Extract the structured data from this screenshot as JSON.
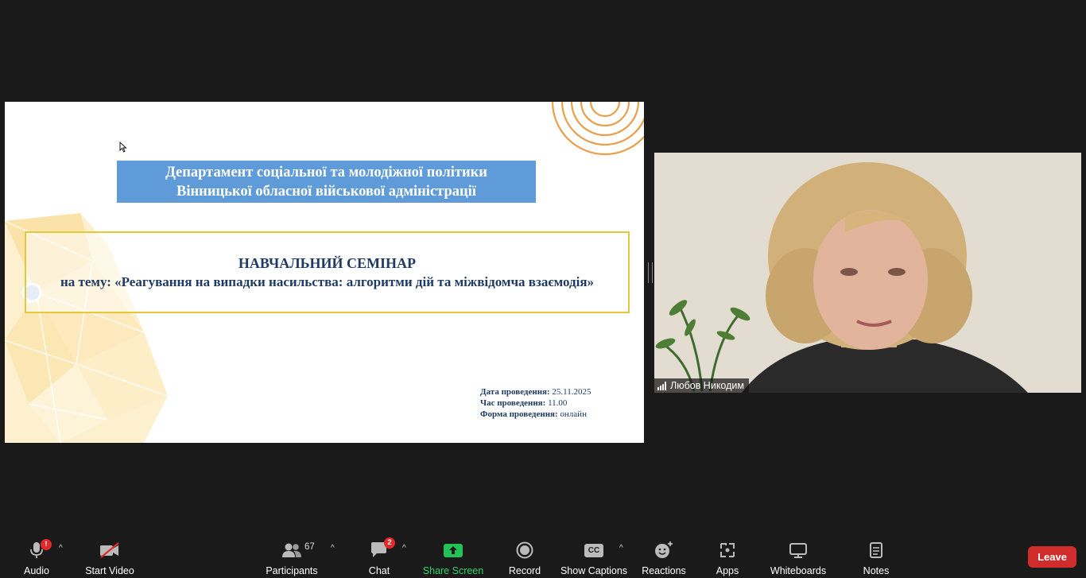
{
  "slide": {
    "department_line1": "Департамент соціальної та молодіжної політики",
    "department_line2": "Вінницької обласної військової адміністрації",
    "seminar_title": "НАВЧАЛЬНИЙ СЕМІНАР",
    "seminar_topic": "на тему: «Реагування на випадки насильства: алгоритми дій та міжвідомча взаємодія»",
    "details": [
      {
        "label": "Дата проведення:",
        "value": "25.11.2025"
      },
      {
        "label": "Час проведення:",
        "value": "11.00"
      },
      {
        "label": "Форма проведення:",
        "value": "онлайн"
      }
    ]
  },
  "video": {
    "participant_name": "Любов Никодим"
  },
  "toolbar": {
    "audio_label": "Audio",
    "audio_badge": "!",
    "video_label": "Start Video",
    "participants_label": "Participants",
    "participants_count": "67",
    "chat_label": "Chat",
    "chat_badge": "2",
    "share_label": "Share Screen",
    "record_label": "Record",
    "captions_label": "Show Captions",
    "captions_icon_text": "CC",
    "reactions_label": "Reactions",
    "apps_label": "Apps",
    "whiteboards_label": "Whiteboards",
    "notes_label": "Notes",
    "leave_label": "Leave"
  },
  "colors": {
    "background": "#1a1a1a",
    "leave": "#d12c2c",
    "share_green": "#2fd36b",
    "badge_red": "#e02a2a",
    "dept_blue": "#5f9bd8",
    "seminar_border": "#e6c63b",
    "slide_text": "#1f3b63"
  }
}
